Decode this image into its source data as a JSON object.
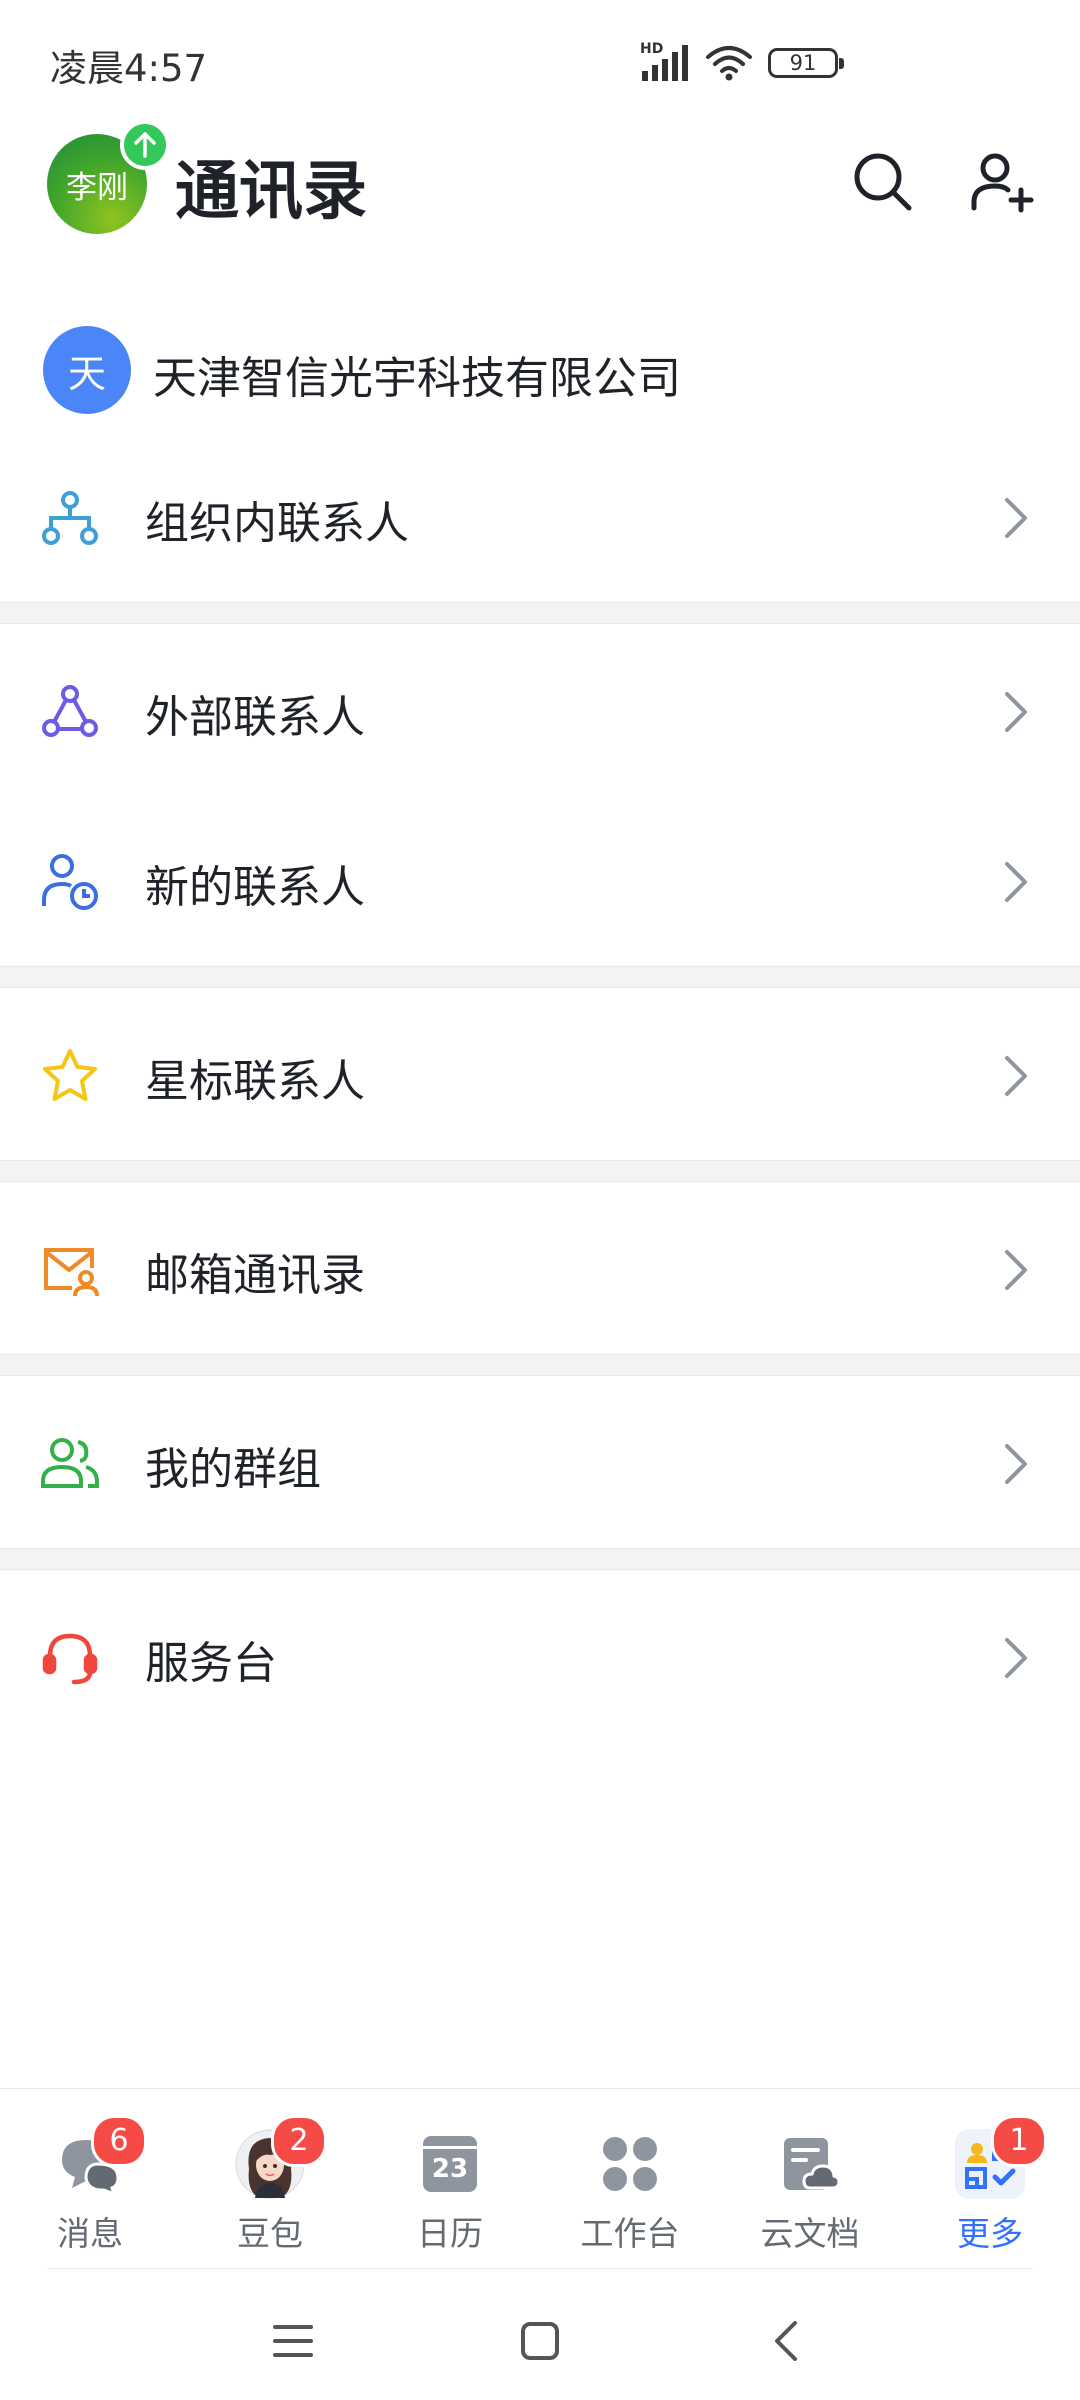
{
  "status_bar": {
    "time": "凌晨4:57",
    "network": "HD",
    "battery": "91"
  },
  "header": {
    "avatar_text": "李刚",
    "title": "通讯录",
    "search_icon": "search-icon",
    "add_contact_icon": "add-contact-icon"
  },
  "company": {
    "avatar_text": "天",
    "name": "天津智信光宇科技有限公司"
  },
  "menu": [
    {
      "label": "组织内联系人",
      "icon": "org-chart-icon",
      "color": "#3fa0d8"
    },
    {
      "label": "外部联系人",
      "icon": "external-contacts-icon",
      "color": "#6b5ce7"
    },
    {
      "label": "新的联系人",
      "icon": "new-contact-icon",
      "color": "#3b6ee0"
    },
    {
      "label": "星标联系人",
      "icon": "star-icon",
      "color": "#f5c518"
    },
    {
      "label": "邮箱通讯录",
      "icon": "mail-contacts-icon",
      "color": "#f08a24"
    },
    {
      "label": "我的群组",
      "icon": "groups-icon",
      "color": "#34b04a"
    },
    {
      "label": "服务台",
      "icon": "headset-icon",
      "color": "#f0463c"
    }
  ],
  "bottom_nav": {
    "items": [
      {
        "label": "消息",
        "badge": "6"
      },
      {
        "label": "豆包",
        "badge": "2"
      },
      {
        "label": "日历",
        "badge": "",
        "date": "23"
      },
      {
        "label": "工作台",
        "badge": ""
      },
      {
        "label": "云文档",
        "badge": ""
      },
      {
        "label": "更多",
        "badge": "1"
      }
    ],
    "active": "更多",
    "active_color": "#3370ff"
  }
}
